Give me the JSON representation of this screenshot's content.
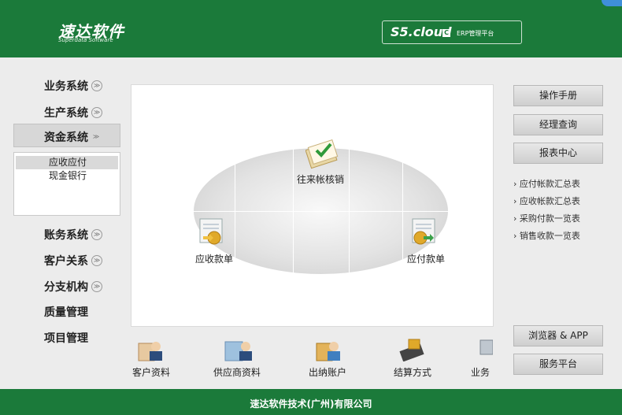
{
  "header": {
    "logo_main": "速达软件",
    "logo_sub": "Superdata Software",
    "platform_s5": "S5.cloud",
    "platform_c": "C",
    "platform_label": "ERP管理平台"
  },
  "sidebar": {
    "items": [
      {
        "label": "业务系统",
        "arrow": "≫"
      },
      {
        "label": "生产系统",
        "arrow": "≫"
      },
      {
        "label": "资金系统",
        "arrow": "≫"
      },
      {
        "label": "账务系统",
        "arrow": "≫"
      },
      {
        "label": "客户关系",
        "arrow": "≫"
      },
      {
        "label": "分支机构",
        "arrow": "≫"
      },
      {
        "label": "质量管理",
        "arrow": ""
      },
      {
        "label": "项目管理",
        "arrow": ""
      }
    ],
    "sub_items": [
      "应收应付",
      "现金银行"
    ]
  },
  "center": {
    "nodes": [
      "往来帐核销",
      "应收款单",
      "应付款单"
    ]
  },
  "right": {
    "buttons": [
      "操作手册",
      "经理查询",
      "报表中心",
      "浏览器 & APP",
      "服务平台"
    ],
    "reports": [
      "应付帐款汇总表",
      "应收帐款汇总表",
      "采购付款一览表",
      "销售收款一览表"
    ]
  },
  "bottom": {
    "items": [
      "客户资料",
      "供应商资料",
      "出纳账户",
      "结算方式",
      "业务"
    ]
  },
  "footer": {
    "company": "速达软件技术(广州)有限公司"
  },
  "colors": {
    "brand_green": "#1b7a3a",
    "background": "#ececec"
  }
}
